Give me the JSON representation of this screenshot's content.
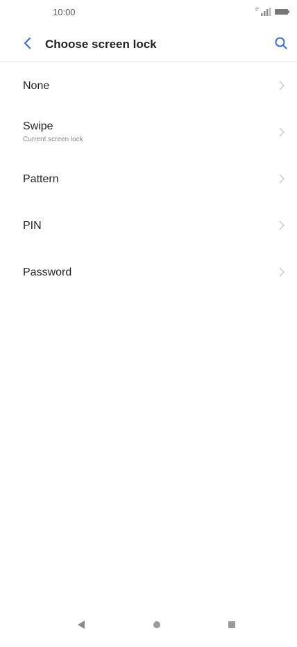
{
  "status_bar": {
    "time": "10:00",
    "signal_icon": "signal-icon",
    "battery_icon": "battery-icon"
  },
  "header": {
    "title": "Choose screen lock",
    "back_icon": "back-arrow-icon",
    "search_icon": "search-icon",
    "accent_color": "#3b6fd8"
  },
  "options": [
    {
      "label": "None",
      "sublabel": ""
    },
    {
      "label": "Swipe",
      "sublabel": "Current screen lock"
    },
    {
      "label": "Pattern",
      "sublabel": ""
    },
    {
      "label": "PIN",
      "sublabel": ""
    },
    {
      "label": "Password",
      "sublabel": ""
    }
  ],
  "nav_bar": {
    "back_icon": "nav-back-icon",
    "home_icon": "nav-home-icon",
    "recents_icon": "nav-recents-icon"
  }
}
